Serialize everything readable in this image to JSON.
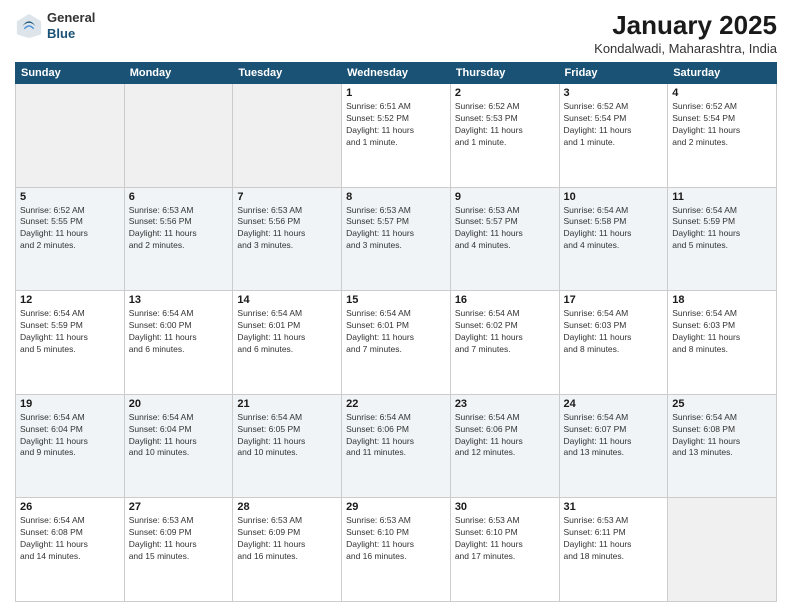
{
  "header": {
    "logo_line1": "General",
    "logo_line2": "Blue",
    "month": "January 2025",
    "location": "Kondalwadi, Maharashtra, India"
  },
  "weekdays": [
    "Sunday",
    "Monday",
    "Tuesday",
    "Wednesday",
    "Thursday",
    "Friday",
    "Saturday"
  ],
  "weeks": [
    [
      {
        "day": "",
        "info": ""
      },
      {
        "day": "",
        "info": ""
      },
      {
        "day": "",
        "info": ""
      },
      {
        "day": "1",
        "info": "Sunrise: 6:51 AM\nSunset: 5:52 PM\nDaylight: 11 hours\nand 1 minute."
      },
      {
        "day": "2",
        "info": "Sunrise: 6:52 AM\nSunset: 5:53 PM\nDaylight: 11 hours\nand 1 minute."
      },
      {
        "day": "3",
        "info": "Sunrise: 6:52 AM\nSunset: 5:54 PM\nDaylight: 11 hours\nand 1 minute."
      },
      {
        "day": "4",
        "info": "Sunrise: 6:52 AM\nSunset: 5:54 PM\nDaylight: 11 hours\nand 2 minutes."
      }
    ],
    [
      {
        "day": "5",
        "info": "Sunrise: 6:52 AM\nSunset: 5:55 PM\nDaylight: 11 hours\nand 2 minutes."
      },
      {
        "day": "6",
        "info": "Sunrise: 6:53 AM\nSunset: 5:56 PM\nDaylight: 11 hours\nand 2 minutes."
      },
      {
        "day": "7",
        "info": "Sunrise: 6:53 AM\nSunset: 5:56 PM\nDaylight: 11 hours\nand 3 minutes."
      },
      {
        "day": "8",
        "info": "Sunrise: 6:53 AM\nSunset: 5:57 PM\nDaylight: 11 hours\nand 3 minutes."
      },
      {
        "day": "9",
        "info": "Sunrise: 6:53 AM\nSunset: 5:57 PM\nDaylight: 11 hours\nand 4 minutes."
      },
      {
        "day": "10",
        "info": "Sunrise: 6:54 AM\nSunset: 5:58 PM\nDaylight: 11 hours\nand 4 minutes."
      },
      {
        "day": "11",
        "info": "Sunrise: 6:54 AM\nSunset: 5:59 PM\nDaylight: 11 hours\nand 5 minutes."
      }
    ],
    [
      {
        "day": "12",
        "info": "Sunrise: 6:54 AM\nSunset: 5:59 PM\nDaylight: 11 hours\nand 5 minutes."
      },
      {
        "day": "13",
        "info": "Sunrise: 6:54 AM\nSunset: 6:00 PM\nDaylight: 11 hours\nand 6 minutes."
      },
      {
        "day": "14",
        "info": "Sunrise: 6:54 AM\nSunset: 6:01 PM\nDaylight: 11 hours\nand 6 minutes."
      },
      {
        "day": "15",
        "info": "Sunrise: 6:54 AM\nSunset: 6:01 PM\nDaylight: 11 hours\nand 7 minutes."
      },
      {
        "day": "16",
        "info": "Sunrise: 6:54 AM\nSunset: 6:02 PM\nDaylight: 11 hours\nand 7 minutes."
      },
      {
        "day": "17",
        "info": "Sunrise: 6:54 AM\nSunset: 6:03 PM\nDaylight: 11 hours\nand 8 minutes."
      },
      {
        "day": "18",
        "info": "Sunrise: 6:54 AM\nSunset: 6:03 PM\nDaylight: 11 hours\nand 8 minutes."
      }
    ],
    [
      {
        "day": "19",
        "info": "Sunrise: 6:54 AM\nSunset: 6:04 PM\nDaylight: 11 hours\nand 9 minutes."
      },
      {
        "day": "20",
        "info": "Sunrise: 6:54 AM\nSunset: 6:04 PM\nDaylight: 11 hours\nand 10 minutes."
      },
      {
        "day": "21",
        "info": "Sunrise: 6:54 AM\nSunset: 6:05 PM\nDaylight: 11 hours\nand 10 minutes."
      },
      {
        "day": "22",
        "info": "Sunrise: 6:54 AM\nSunset: 6:06 PM\nDaylight: 11 hours\nand 11 minutes."
      },
      {
        "day": "23",
        "info": "Sunrise: 6:54 AM\nSunset: 6:06 PM\nDaylight: 11 hours\nand 12 minutes."
      },
      {
        "day": "24",
        "info": "Sunrise: 6:54 AM\nSunset: 6:07 PM\nDaylight: 11 hours\nand 13 minutes."
      },
      {
        "day": "25",
        "info": "Sunrise: 6:54 AM\nSunset: 6:08 PM\nDaylight: 11 hours\nand 13 minutes."
      }
    ],
    [
      {
        "day": "26",
        "info": "Sunrise: 6:54 AM\nSunset: 6:08 PM\nDaylight: 11 hours\nand 14 minutes."
      },
      {
        "day": "27",
        "info": "Sunrise: 6:53 AM\nSunset: 6:09 PM\nDaylight: 11 hours\nand 15 minutes."
      },
      {
        "day": "28",
        "info": "Sunrise: 6:53 AM\nSunset: 6:09 PM\nDaylight: 11 hours\nand 16 minutes."
      },
      {
        "day": "29",
        "info": "Sunrise: 6:53 AM\nSunset: 6:10 PM\nDaylight: 11 hours\nand 16 minutes."
      },
      {
        "day": "30",
        "info": "Sunrise: 6:53 AM\nSunset: 6:10 PM\nDaylight: 11 hours\nand 17 minutes."
      },
      {
        "day": "31",
        "info": "Sunrise: 6:53 AM\nSunset: 6:11 PM\nDaylight: 11 hours\nand 18 minutes."
      },
      {
        "day": "",
        "info": ""
      }
    ]
  ]
}
